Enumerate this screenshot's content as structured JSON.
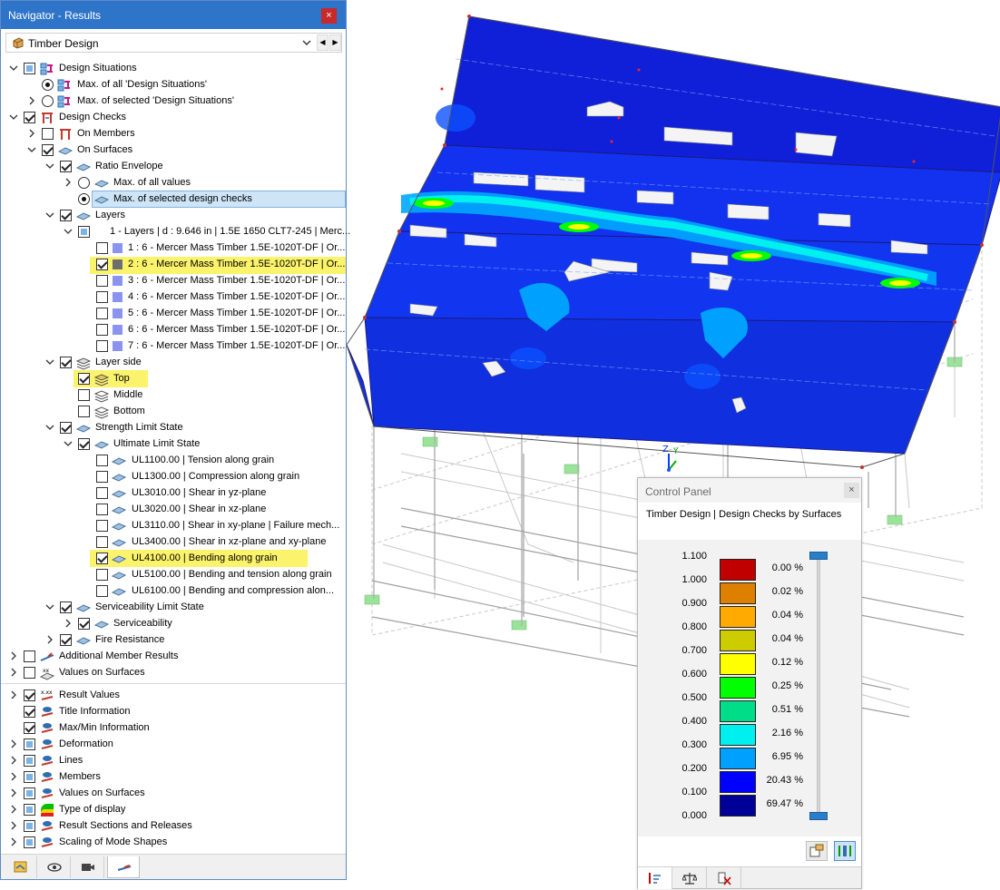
{
  "navigator": {
    "title": "Navigator - Results",
    "close": "×",
    "selector": {
      "value": "Timber Design",
      "prev": "◀",
      "next": "▶"
    },
    "tree": {
      "design_situations": "Design Situations",
      "max_all_ds": "Max. of all 'Design Situations'",
      "max_selected_ds": "Max. of selected 'Design Situations'",
      "design_checks": "Design Checks",
      "on_members": "On Members",
      "on_surfaces": "On Surfaces",
      "ratio_envelope": "Ratio Envelope",
      "max_all_values": "Max. of all values",
      "max_selected_checks": "Max. of selected design checks",
      "layers": "Layers",
      "layers_group": "1 - Layers | d : 9.646 in | 1.5E 1650 CLT7-245 | Merc...",
      "layer_items": [
        "1 : 6 - Mercer Mass Timber 1.5E-1020T-DF | Or...",
        "2 : 6 - Mercer Mass Timber 1.5E-1020T-DF | Or...",
        "3 : 6 - Mercer Mass Timber 1.5E-1020T-DF | Or...",
        "4 : 6 - Mercer Mass Timber 1.5E-1020T-DF | Or...",
        "5 : 6 - Mercer Mass Timber 1.5E-1020T-DF | Or...",
        "6 : 6 - Mercer Mass Timber 1.5E-1020T-DF | Or...",
        "7 : 6 - Mercer Mass Timber 1.5E-1020T-DF | Or..."
      ],
      "layer_side": "Layer side",
      "top": "Top",
      "middle": "Middle",
      "bottom": "Bottom",
      "strength_ls": "Strength Limit State",
      "ultimate_ls": "Ultimate Limit State",
      "checks": [
        "UL1100.00 | Tension along grain",
        "UL1300.00 | Compression along grain",
        "UL3010.00 | Shear in yz-plane",
        "UL3020.00 | Shear in xz-plane",
        "UL3110.00 | Shear in xy-plane | Failure mech...",
        "UL3400.00 | Shear in xz-plane and xy-plane",
        "UL4100.00 | Bending along grain",
        "UL5100.00 | Bending and tension along grain",
        "UL6100.00 | Bending and compression alon..."
      ],
      "serviceability_ls": "Serviceability Limit State",
      "serviceability": "Serviceability",
      "fire_resistance": "Fire Resistance",
      "additional_member_results": "Additional Member Results",
      "values_on_surfaces_1": "Values on Surfaces",
      "result_values": "Result Values",
      "title_information": "Title Information",
      "maxmin_information": "Max/Min Information",
      "deformation": "Deformation",
      "lines": "Lines",
      "members": "Members",
      "values_on_surfaces_2": "Values on Surfaces",
      "type_of_display": "Type of display",
      "result_sections": "Result Sections and Releases",
      "scaling_mode_shapes": "Scaling of Mode Shapes"
    }
  },
  "colors": {
    "highlight": "#fbf36b",
    "titlebar": "#2e74c9",
    "layer_swatch": "#8a93f0",
    "layer_swatch_active": "#6e6e6e"
  },
  "view": {
    "axis_z": "Z",
    "axis_y": "Y"
  },
  "control_panel": {
    "title": "Control Panel",
    "close": "×",
    "subtitle": "Timber Design | Design Checks by Surfaces",
    "legend_values": [
      "1.100",
      "1.000",
      "0.900",
      "0.800",
      "0.700",
      "0.600",
      "0.500",
      "0.400",
      "0.300",
      "0.200",
      "0.100",
      "0.000"
    ],
    "legend_bands": [
      {
        "color": "#c00000",
        "pct": "0.00 %"
      },
      {
        "color": "#dd7f00",
        "pct": "0.02 %"
      },
      {
        "color": "#ffaa00",
        "pct": "0.04 %"
      },
      {
        "color": "#cccc00",
        "pct": "0.04 %"
      },
      {
        "color": "#ffff00",
        "pct": "0.12 %"
      },
      {
        "color": "#00ff00",
        "pct": "0.25 %"
      },
      {
        "color": "#00dd88",
        "pct": "0.51 %"
      },
      {
        "color": "#00f0f0",
        "pct": "2.16 %"
      },
      {
        "color": "#00a0ff",
        "pct": "6.95 %"
      },
      {
        "color": "#0000ff",
        "pct": "20.43 %"
      },
      {
        "color": "#000099",
        "pct": "69.47 %"
      }
    ]
  }
}
